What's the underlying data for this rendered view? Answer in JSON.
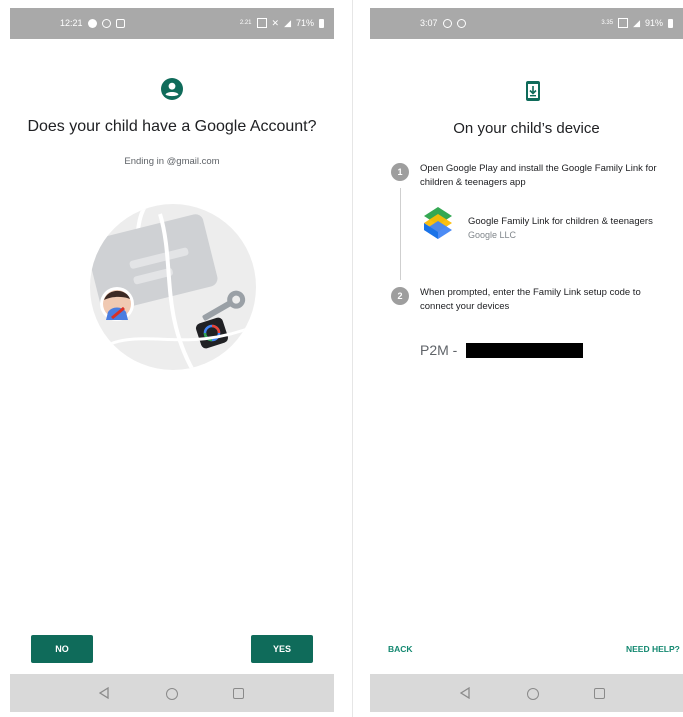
{
  "left_screen": {
    "status_bar": {
      "time": "12:21",
      "battery": "71%",
      "speed": "2.21"
    },
    "title": "Does your child have a Google Account?",
    "subtitle": "Ending in @gmail.com",
    "buttons": {
      "no": "NO",
      "yes": "YES"
    }
  },
  "right_screen": {
    "status_bar": {
      "time": "3:07",
      "battery": "91%",
      "speed": "3.35"
    },
    "title": "On your child’s device",
    "steps": [
      {
        "number": "1",
        "text": "Open Google Play and install the Google Family Link for children & teenagers app"
      },
      {
        "number": "2",
        "text": "When prompted, enter the Family Link setup code to connect your devices"
      }
    ],
    "app": {
      "name": "Google Family Link for children & teenagers",
      "developer": "Google LLC"
    },
    "setup_code_prefix": "P2M -",
    "links": {
      "back": "BACK",
      "need_help": "NEED HELP?"
    }
  },
  "colors": {
    "accent": "#0f6b5a",
    "link": "#138870",
    "status_bar": "#a9a9a9",
    "nav_bar": "#d9d9d9"
  },
  "icons": [
    "account-circle-icon",
    "device-download-icon",
    "family-link-logo",
    "nav-back-icon",
    "nav-home-icon",
    "nav-recent-icon"
  ]
}
